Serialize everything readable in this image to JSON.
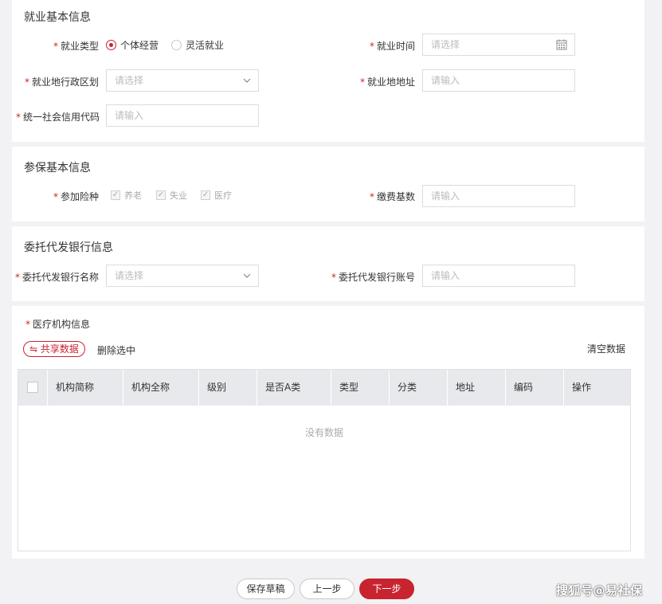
{
  "employment": {
    "title": "就业基本信息",
    "type_label": "就业类型",
    "type_options": [
      "个体经营",
      "灵活就业"
    ],
    "time_label": "就业时间",
    "time_placeholder": "请选择",
    "region_label": "就业地行政区划",
    "region_placeholder": "请选择",
    "address_label": "就业地地址",
    "address_placeholder": "请输入",
    "credit_label": "统一社会信用代码",
    "credit_placeholder": "请输入"
  },
  "insurance": {
    "title": "参保基本信息",
    "types_label": "参加险种",
    "types": [
      "养老",
      "失业",
      "医疗"
    ],
    "base_label": "缴费基数",
    "base_placeholder": "请输入"
  },
  "bank": {
    "title": "委托代发银行信息",
    "name_label": "委托代发银行名称",
    "name_placeholder": "请选择",
    "account_label": "委托代发银行账号",
    "account_placeholder": "请输入"
  },
  "medical": {
    "title": "医疗机构信息",
    "share_button": "⇋ 共享数据",
    "delete_selected": "删除选中",
    "clear_data": "清空数据",
    "columns": [
      "机构简称",
      "机构全称",
      "级别",
      "是否A类",
      "类型",
      "分类",
      "地址",
      "编码",
      "操作"
    ],
    "empty_text": "没有数据"
  },
  "footer": {
    "save_draft": "保存草稿",
    "prev": "上一步",
    "next": "下一步"
  },
  "watermark": "搜狐号@易社保",
  "colors": {
    "accent": "#c8242f",
    "background": "#f2f2f4"
  }
}
